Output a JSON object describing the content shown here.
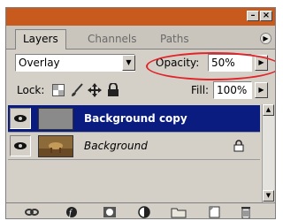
{
  "tabs": [
    {
      "label": "Layers",
      "active": true
    },
    {
      "label": "Channels",
      "active": false
    },
    {
      "label": "Paths",
      "active": false
    }
  ],
  "blend_mode": {
    "value": "Overlay"
  },
  "opacity": {
    "label": "Opacity:",
    "value": "50%"
  },
  "lock": {
    "label": "Lock:"
  },
  "fill": {
    "label": "Fill:",
    "value": "100%"
  },
  "layers": [
    {
      "name": "Background copy",
      "selected": true,
      "visible": true,
      "locked": false
    },
    {
      "name": "Background",
      "selected": false,
      "visible": true,
      "locked": true
    }
  ],
  "colors": {
    "titlebar": "#c85a1e",
    "selection": "#0b1c80",
    "highlight_circle": "#e0242a",
    "panel": "#d4d0c8"
  },
  "icons": {
    "titlebar": [
      "minimize-icon",
      "close-icon"
    ],
    "lock": [
      "lock-transparency-icon",
      "lock-brush-icon",
      "lock-move-icon",
      "lock-all-icon"
    ],
    "bottom": [
      "link-layers-icon",
      "layer-style-icon",
      "add-mask-icon",
      "adjustment-layer-icon",
      "new-group-icon",
      "new-layer-icon",
      "trash-icon"
    ]
  }
}
